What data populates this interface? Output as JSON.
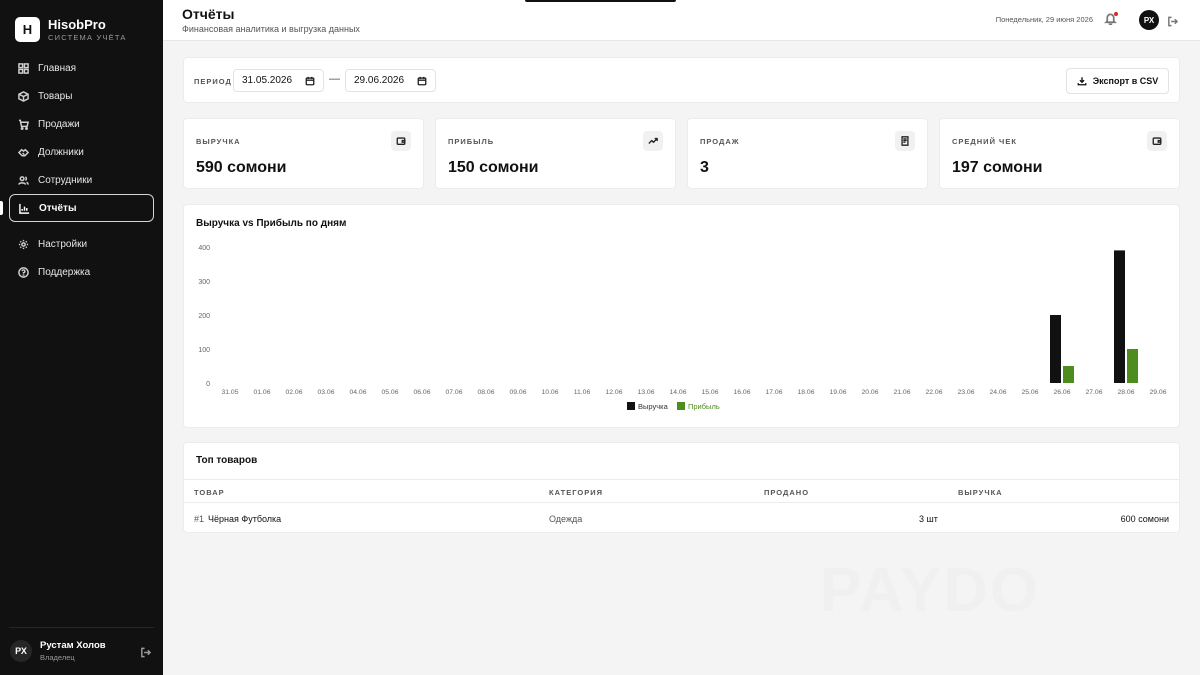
{
  "brand": {
    "logo_letter": "H",
    "name": "HisobPro",
    "subtitle": "СИСТЕМА УЧЁТА"
  },
  "sidebar": {
    "items": [
      {
        "label": "Главная",
        "icon": "grid-icon"
      },
      {
        "label": "Товары",
        "icon": "box-icon"
      },
      {
        "label": "Продажи",
        "icon": "cart-icon"
      },
      {
        "label": "Должники",
        "icon": "handshake-icon"
      },
      {
        "label": "Сотрудники",
        "icon": "users-icon"
      },
      {
        "label": "Отчёты",
        "icon": "chart-icon",
        "active": true
      },
      {
        "label": "Настройки",
        "icon": "gear-icon"
      },
      {
        "label": "Поддержка",
        "icon": "help-icon"
      }
    ],
    "user": {
      "initials": "РХ",
      "name": "Рустам Холов",
      "role": "Владелец"
    }
  },
  "header": {
    "title": "Отчёты",
    "subtitle": "Финансовая аналитика и выгрузка данных",
    "date": "Понедельник, 29 июня 2026",
    "avatar_initials": "РХ"
  },
  "filter": {
    "period_label": "ПЕРИОД",
    "date_from": "31.05.2026",
    "date_to": "29.06.2026",
    "separator": "—",
    "export_label": "Экспорт в CSV"
  },
  "stats": [
    {
      "label": "ВЫРУЧКА",
      "value": "590 сомони",
      "icon": "wallet-icon"
    },
    {
      "label": "ПРИБЫЛЬ",
      "value": "150 сомони",
      "icon": "trend-up-icon"
    },
    {
      "label": "ПРОДАЖ",
      "value": "3",
      "icon": "receipt-icon"
    },
    {
      "label": "СРЕДНИЙ ЧЕК",
      "value": "197 сомони",
      "icon": "wallet-icon"
    }
  ],
  "chart_data": {
    "type": "bar",
    "title": "Выручка vs Прибыль по дням",
    "categories": [
      "31.05",
      "01.06",
      "02.06",
      "03.06",
      "04.06",
      "05.06",
      "06.06",
      "07.06",
      "08.06",
      "09.06",
      "10.06",
      "11.06",
      "12.06",
      "13.06",
      "14.06",
      "15.06",
      "16.06",
      "17.06",
      "18.06",
      "19.06",
      "20.06",
      "21.06",
      "22.06",
      "23.06",
      "24.06",
      "25.06",
      "26.06",
      "27.06",
      "28.06",
      "29.06"
    ],
    "series": [
      {
        "name": "Выручка",
        "color": "#111111",
        "values": [
          0,
          0,
          0,
          0,
          0,
          0,
          0,
          0,
          0,
          0,
          0,
          0,
          0,
          0,
          0,
          0,
          0,
          0,
          0,
          0,
          0,
          0,
          0,
          0,
          0,
          0,
          200,
          0,
          390,
          0
        ]
      },
      {
        "name": "Прибыль",
        "color": "#4d8c1f",
        "values": [
          0,
          0,
          0,
          0,
          0,
          0,
          0,
          0,
          0,
          0,
          0,
          0,
          0,
          0,
          0,
          0,
          0,
          0,
          0,
          0,
          0,
          0,
          0,
          0,
          0,
          0,
          50,
          0,
          100,
          0
        ]
      }
    ],
    "yticks": [
      0,
      100,
      200,
      300,
      400
    ],
    "ylim": [
      0,
      400
    ],
    "legend": "bottom-center",
    "grid": false
  },
  "top_products": {
    "title": "Топ товаров",
    "columns": [
      "ТОВАР",
      "КАТЕГОРИЯ",
      "ПРОДАНО",
      "ВЫРУЧКА"
    ],
    "rows": [
      {
        "rank": "#1",
        "name": "Чёрная Футболка",
        "category": "Одежда",
        "sold": "3 шт",
        "revenue": "600 сомони"
      }
    ]
  },
  "watermark": "PAYDO"
}
